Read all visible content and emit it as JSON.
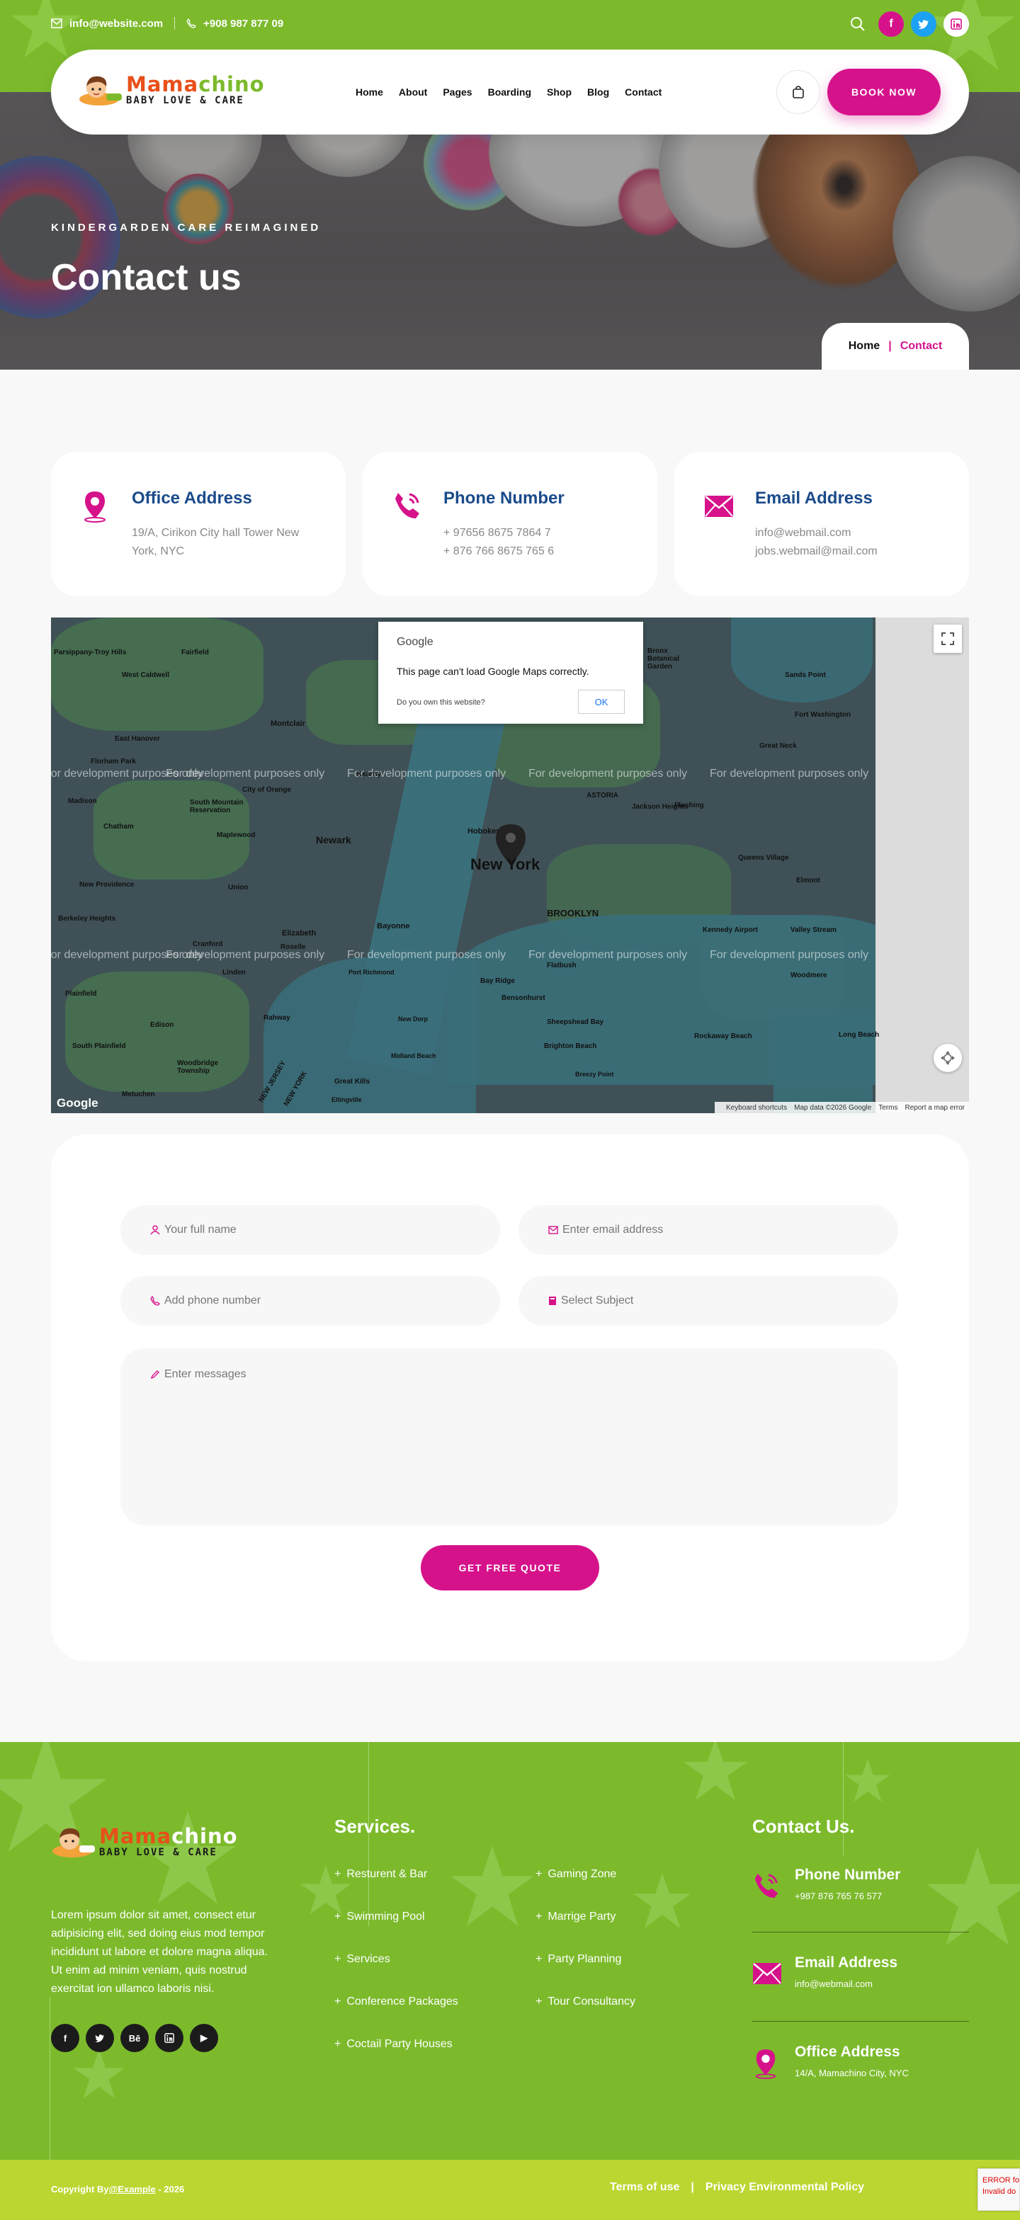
{
  "topbar": {
    "email": "info@website.com",
    "phone": "+908 987 877 09",
    "social": [
      "facebook-icon",
      "twitter-icon",
      "linkedin-icon"
    ],
    "colors": {
      "facebook": "#d6128b",
      "twitter": "#1da1f2",
      "linkedin": "#ffffff"
    }
  },
  "header": {
    "logo_word_a": "Mama",
    "logo_word_b": "chino",
    "logo_tagline": "BABY LOVE & CARE",
    "nav": [
      "Home",
      "About",
      "Pages",
      "Boarding",
      "Shop",
      "Blog",
      "Contact"
    ],
    "book_label": "BOOK NOW"
  },
  "hero": {
    "subtitle": "KINDERGARDEN CARE REIMAGINED",
    "title": "Contact us",
    "breadcrumb_home": "Home",
    "breadcrumb_sep": "|",
    "breadcrumb_current": "Contact"
  },
  "cards": [
    {
      "title": "Office Address",
      "lines": [
        "19/A, Cirikon City hall Tower New York, NYC"
      ],
      "icon": "location-pin-icon"
    },
    {
      "title": "Phone Number",
      "lines": [
        "+ 97656 8675 7864 7",
        "+ 876 766 8675 765 6"
      ],
      "icon": "phone-icon"
    },
    {
      "title": "Email Address",
      "lines": [
        "info@webmail.com",
        "jobs.webmail@mail.com"
      ],
      "icon": "envelope-icon"
    }
  ],
  "map": {
    "dialog_brand": "Google",
    "dialog_message": "This page can't load Google Maps correctly.",
    "dialog_question": "Do you own this website?",
    "dialog_ok": "OK",
    "watermark": "For development purposes only",
    "city_label": "New York",
    "labels": [
      "Newark",
      "BROOKLYN",
      "ASTORIA",
      "Hoboken",
      "Montclair",
      "Elizabeth",
      "Bayonne",
      "Fort Washington",
      "Great Neck",
      "Sands Point",
      "Elmont",
      "Valley Stream",
      "Woodmere",
      "Long Beach",
      "West Caldwell",
      "Fairfield",
      "East Hanover",
      "Florham Park",
      "Madison",
      "Chatham",
      "South Mountain Reservation",
      "Maplewood",
      "New Providence",
      "Berkeley Heights",
      "Union",
      "Roselle",
      "Cranford",
      "Linden",
      "Plainfield",
      "South Plainfield",
      "Woodbridge Township",
      "Metuchen",
      "Port Richmond",
      "New Dorp",
      "Midland Beach",
      "Bay Ridge",
      "Sheepshead Bay",
      "Brighton Beach",
      "Rockaway Beach",
      "Kennedy Airport",
      "Flatbush",
      "Bensonhurst",
      "Flushing",
      "Queens Village",
      "Jackson Heights",
      "Parsippany-Troy Hills",
      "City of Orange",
      "Kearny",
      "Rahway",
      "Edison",
      "Great Kills",
      "Eltingville",
      "Breezy Point",
      "NEW JERSEY",
      "NEW YORK",
      "Bronx Botanical Garden"
    ],
    "google_mark": "Google",
    "attrib_shortcuts": "Keyboard shortcuts",
    "attrib_data": "Map data ©2026 Google",
    "attrib_terms": "Terms",
    "attrib_report": "Report a map error"
  },
  "form": {
    "name_placeholder": "Your full name",
    "email_placeholder": "Enter email address",
    "phone_placeholder": "Add phone number",
    "subject_placeholder": "Select Subject",
    "message_placeholder": "Enter messages",
    "submit_label": "GET FREE QUOTE"
  },
  "footer": {
    "about": "Lorem ipsum dolor sit amet, consect etur adipisicing elit, sed doing eius mod tempor incididunt ut labore et dolore magna aliqua. Ut enim ad minim veniam, quis nostrud exercitat ion ullamco laboris nisi.",
    "social": [
      "f",
      "t",
      "Bē",
      "in",
      "▶"
    ],
    "services_title": "Services.",
    "services_col1": [
      "Resturent & Bar",
      "Swimming Pool",
      "Services",
      "Conference Packages",
      "Coctail Party Houses"
    ],
    "services_col2": [
      "Gaming Zone",
      "Marrige Party",
      "Party Planning",
      "Tour Consultancy"
    ],
    "contact_title": "Contact Us.",
    "contacts": [
      {
        "title": "Phone Number",
        "value": "+987 876 765 76 577",
        "icon": "phone-icon"
      },
      {
        "title": "Email Address",
        "value": "info@webmail.com",
        "icon": "envelope-icon"
      },
      {
        "title": "Office Address",
        "value": "14/A, Mamachino City, NYC",
        "icon": "location-pin-icon"
      }
    ]
  },
  "bottom": {
    "copyright_prefix": "Copyright By",
    "copyright_link": "@Example",
    "copyright_suffix": " - 2026",
    "terms": "Terms of use",
    "sep": "|",
    "privacy": "Privacy Environmental Policy"
  },
  "recaptcha": {
    "line1": "ERROR fo",
    "line2": "Invalid do"
  },
  "colors": {
    "primary": "#d6128b",
    "green": "#7cba2c",
    "lime": "#bcd631",
    "title_blue": "#1a4a8a"
  }
}
